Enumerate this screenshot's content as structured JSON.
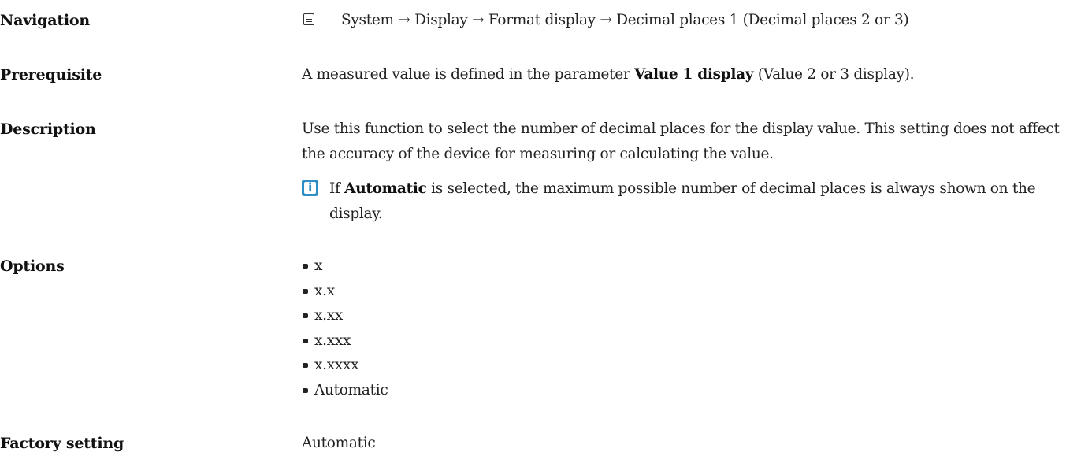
{
  "navigation": {
    "label": "Navigation",
    "icon": "menu-display-icon",
    "path": "System → Display → Format display → Decimal places 1 (Decimal places 2 or 3)"
  },
  "prerequisite": {
    "label": "Prerequisite",
    "text_before": "A measured value is defined in the parameter ",
    "param": "Value 1 display",
    "text_after": " (Value 2 or 3 display)."
  },
  "description": {
    "label": "Description",
    "text": "Use this function to select the number of decimal places for the display value. This setting does not affect the accuracy of the device for measuring or calculating the value.",
    "note": {
      "icon": "info-icon",
      "text_before": "If ",
      "bold": "Automatic",
      "text_after": " is selected, the maximum possible number of decimal places is always shown on the display."
    }
  },
  "options": {
    "label": "Options",
    "items": [
      "x",
      "x.x",
      "x.xx",
      "x.xxx",
      "x.xxxx",
      "Automatic"
    ]
  },
  "factory_setting": {
    "label": "Factory setting",
    "value": "Automatic"
  }
}
